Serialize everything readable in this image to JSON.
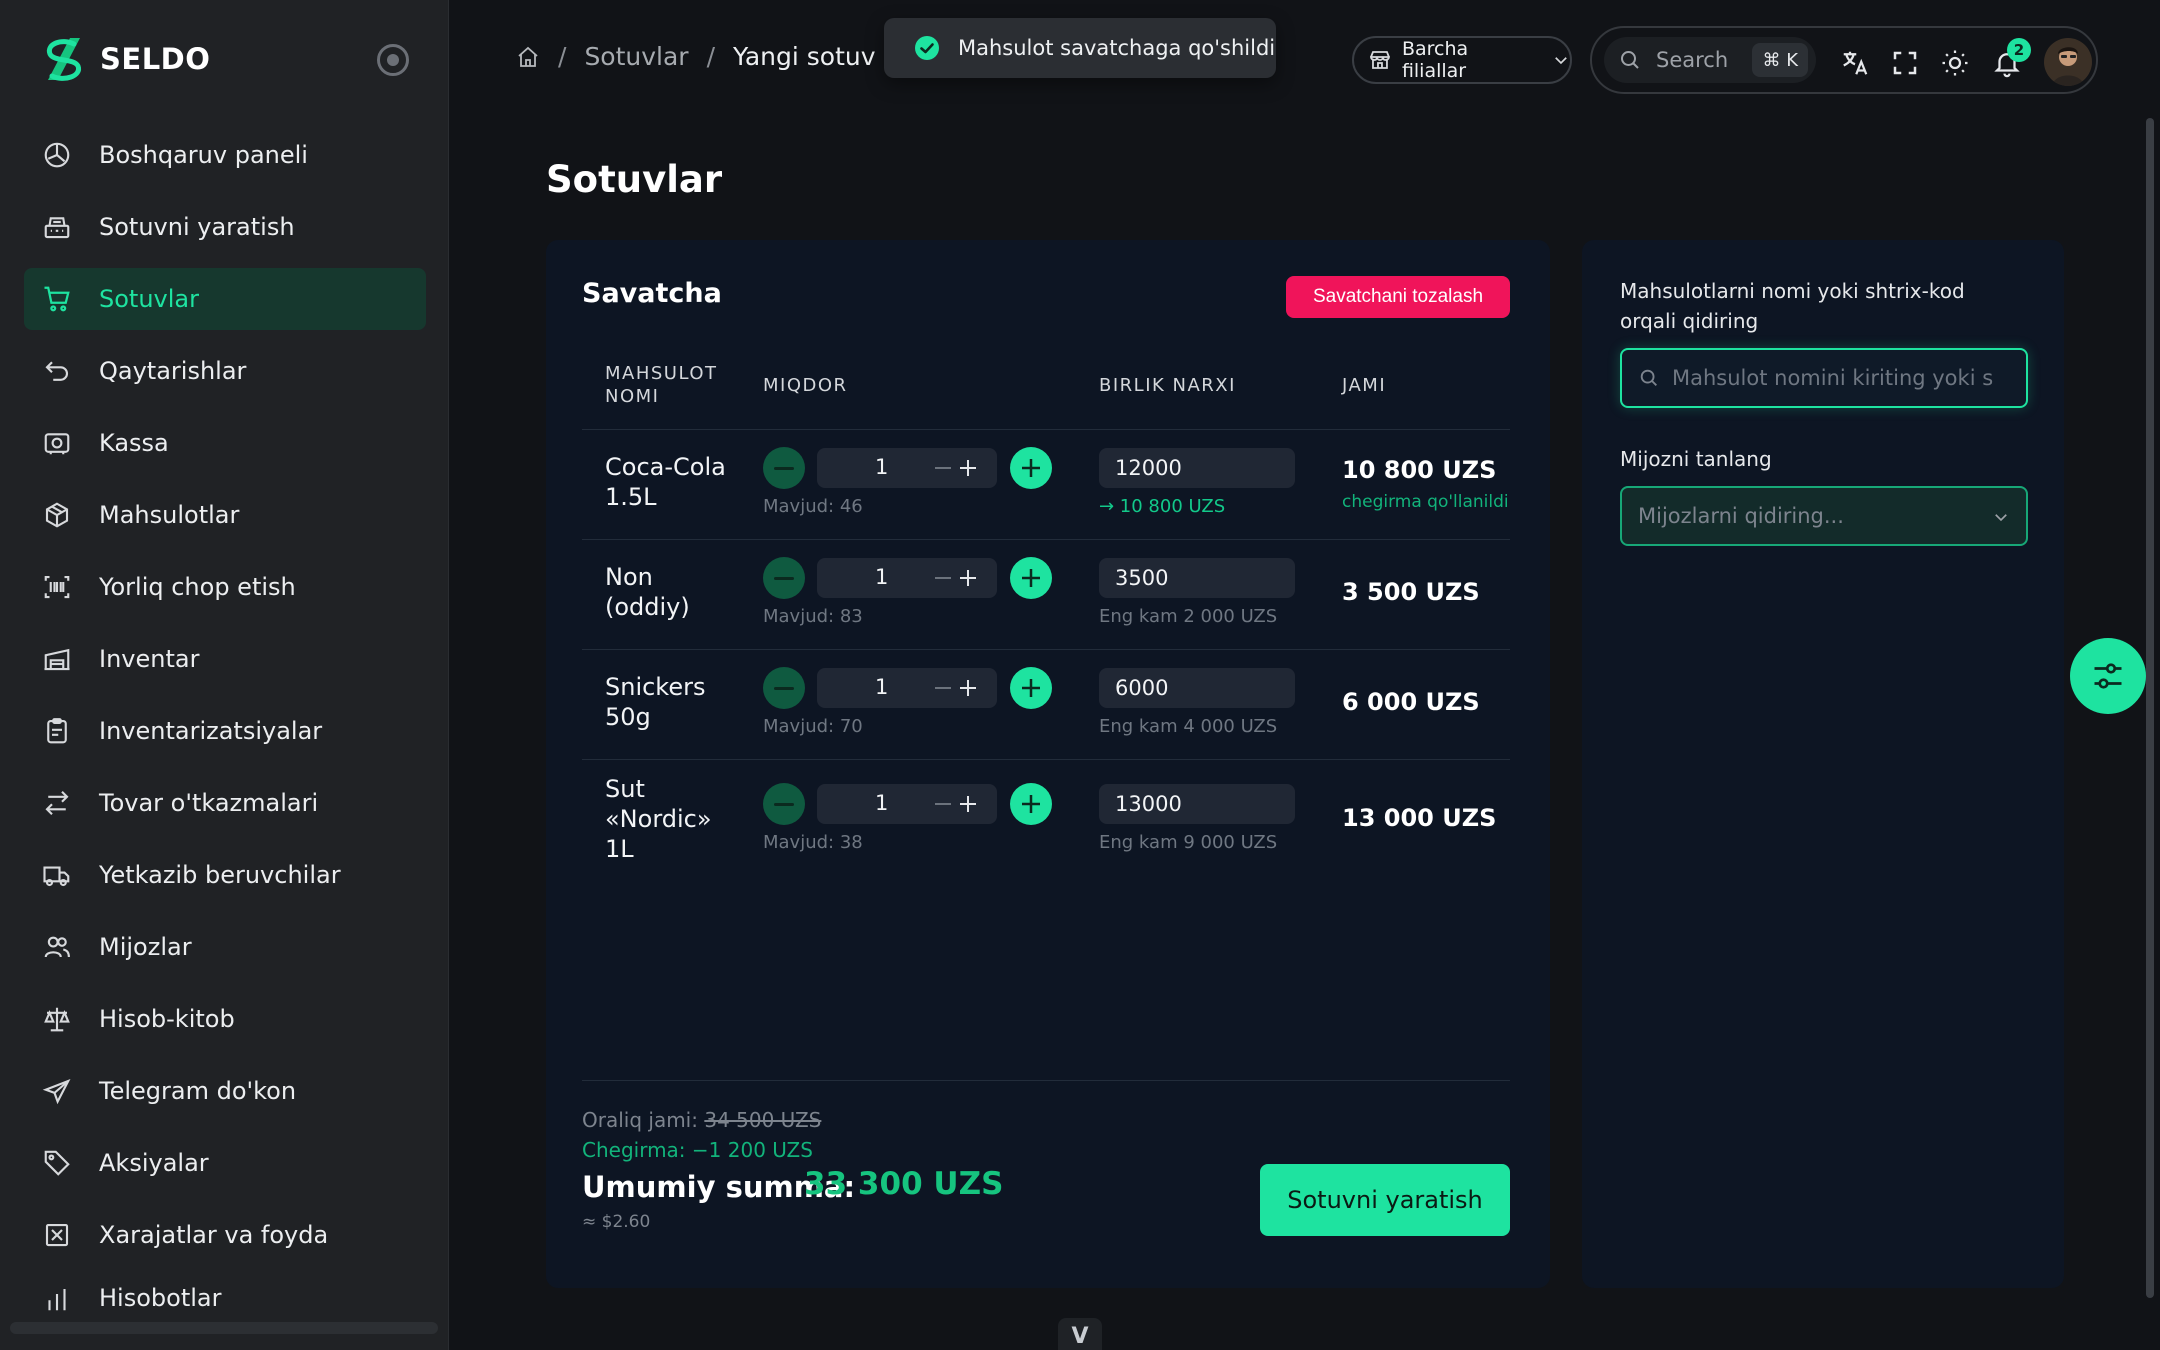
{
  "brand": {
    "name": "SELDO"
  },
  "sidebar": {
    "items": [
      {
        "label": "Boshqaruv paneli",
        "icon": "dashboard-icon",
        "active": false
      },
      {
        "label": "Sotuvni yaratish",
        "icon": "cash-register-icon",
        "active": false
      },
      {
        "label": "Sotuvlar",
        "icon": "cart-icon",
        "active": true
      },
      {
        "label": "Qaytarishlar",
        "icon": "return-icon",
        "active": false
      },
      {
        "label": "Kassa",
        "icon": "cashbox-icon",
        "active": false
      },
      {
        "label": "Mahsulotlar",
        "icon": "box-icon",
        "active": false
      },
      {
        "label": "Yorliq chop etish",
        "icon": "barcode-icon",
        "active": false
      },
      {
        "label": "Inventar",
        "icon": "warehouse-icon",
        "active": false
      },
      {
        "label": "Inventarizatsiyalar",
        "icon": "clipboard-icon",
        "active": false
      },
      {
        "label": "Tovar o'tkazmalari",
        "icon": "transfer-icon",
        "active": false
      },
      {
        "label": "Yetkazib beruvchilar",
        "icon": "truck-icon",
        "active": false
      },
      {
        "label": "Mijozlar",
        "icon": "users-icon",
        "active": false
      },
      {
        "label": "Hisob-kitob",
        "icon": "scale-icon",
        "active": false
      },
      {
        "label": "Telegram do'kon",
        "icon": "telegram-icon",
        "active": false
      },
      {
        "label": "Aksiyalar",
        "icon": "tag-icon",
        "active": false
      },
      {
        "label": "Xarajatlar va foyda",
        "icon": "expense-icon",
        "active": false
      },
      {
        "label": "Hisobotlar",
        "icon": "report-icon",
        "active": false
      }
    ]
  },
  "breadcrumb": {
    "items": [
      "Sotuvlar",
      "Yangi sotuv"
    ]
  },
  "toast": {
    "message": "Mahsulot savatchaga qo'shildi"
  },
  "header": {
    "branch_label": "Barcha filiallar",
    "search_placeholder": "Search",
    "search_shortcut": "⌘ K",
    "notification_count": "2"
  },
  "page": {
    "title": "Sotuvlar"
  },
  "cart": {
    "title": "Savatcha",
    "clear_label": "Savatchani tozalash",
    "columns": {
      "name": "MAHSULOT NOMI",
      "qty": "MIQDOR",
      "price": "BIRLIK NARXI",
      "total": "JAMI"
    },
    "items": [
      {
        "name": "Coca-Cola 1.5L",
        "qty": "1",
        "stock": "Mavjud: 46",
        "price": "12000",
        "price_note": "→ 10 800 UZS",
        "total": "10 800 UZS",
        "total_note": "chegirma qo'llanildi"
      },
      {
        "name": "Non (oddiy)",
        "qty": "1",
        "stock": "Mavjud: 83",
        "price": "3500",
        "price_note": "Eng kam 2 000 UZS",
        "total": "3 500 UZS",
        "total_note": ""
      },
      {
        "name": "Snickers 50g",
        "qty": "1",
        "stock": "Mavjud: 70",
        "price": "6000",
        "price_note": "Eng kam 4 000 UZS",
        "total": "6 000 UZS",
        "total_note": ""
      },
      {
        "name": "Sut «Nordic» 1L",
        "qty": "1",
        "stock": "Mavjud: 38",
        "price": "13000",
        "price_note": "Eng kam 9 000 UZS",
        "total": "13 000 UZS",
        "total_note": ""
      }
    ],
    "subtotal_label": "Oraliq jami:",
    "subtotal_value": "34 500 UZS",
    "discount": "Chegirma: −1 200 UZS",
    "grand_label": "Umumiy summa:",
    "grand_value": "33 300 UZS",
    "approx": "≈ $2.60",
    "create_label": "Sotuvni yaratish"
  },
  "side": {
    "search_label": "Mahsulotlarni nomi yoki shtrix-kod orqali qidiring",
    "search_placeholder": "Mahsulot nomini kiriting yoki s",
    "client_label": "Mijozni tanlang",
    "client_placeholder": "Mijozlarni qidiring..."
  },
  "footer": {
    "vue_badge": "V"
  },
  "colors": {
    "accent": "#1ee3a0",
    "danger": "#f0145a",
    "active_bg": "#16382e",
    "card_bg": "#0d1523"
  }
}
